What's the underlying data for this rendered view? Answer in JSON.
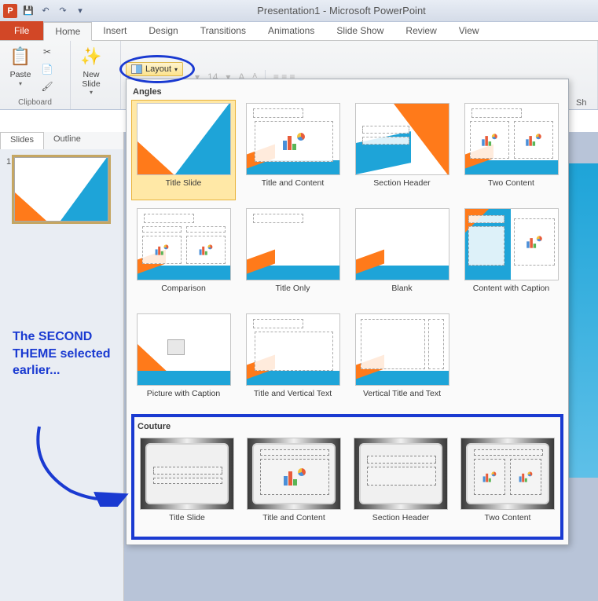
{
  "titlebar": {
    "app_initial": "P",
    "title": "Presentation1 - Microsoft PowerPoint"
  },
  "qat": {
    "save": "💾",
    "undo": "↶",
    "redo": "↷",
    "more": "▾"
  },
  "tabs": {
    "file": "File",
    "home": "Home",
    "insert": "Insert",
    "design": "Design",
    "transitions": "Transitions",
    "animations": "Animations",
    "slideshow": "Slide Show",
    "review": "Review",
    "view": "View"
  },
  "ribbon": {
    "clipboard": {
      "title": "Clipboard",
      "paste": "Paste",
      "cut": "✂",
      "copy": "📄",
      "format": "🖌"
    },
    "slides": {
      "new_slide": "New\nSlide",
      "sparkle": "✨"
    },
    "layout_btn": "Layout",
    "font_size": "14",
    "shapes_label": "Sh"
  },
  "pane": {
    "tab_slides": "Slides",
    "tab_outline": "Outline",
    "slide_num": "1"
  },
  "dropdown": {
    "section1": "Angles",
    "angles": [
      "Title Slide",
      "Title and Content",
      "Section Header",
      "Two Content",
      "Comparison",
      "Title Only",
      "Blank",
      "Content with Caption",
      "Picture with Caption",
      "Title and Vertical Text",
      "Vertical Title and Text"
    ],
    "section2": "Couture",
    "couture": [
      "Title Slide",
      "Title and Content",
      "Section Header",
      "Two Content"
    ]
  },
  "annotation": "The SECOND THEME selected earlier..."
}
